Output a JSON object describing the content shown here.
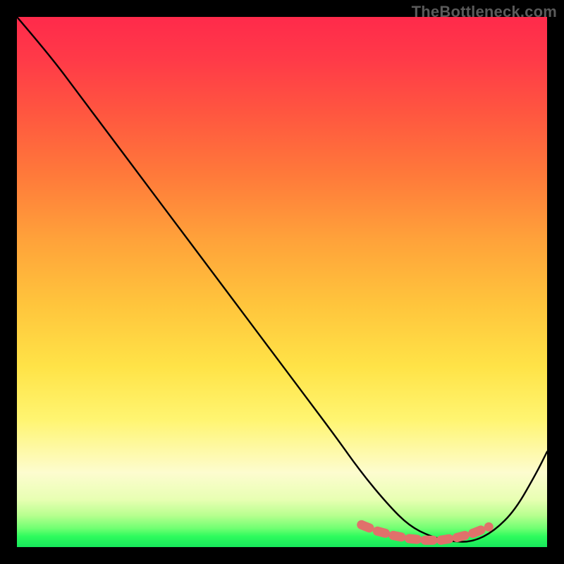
{
  "watermark": "TheBottleneck.com",
  "chart_data": {
    "type": "line",
    "title": "",
    "xlabel": "",
    "ylabel": "",
    "xlim": [
      0,
      100
    ],
    "ylim": [
      0,
      100
    ],
    "grid": false,
    "legend": false,
    "background_gradient": {
      "orientation": "vertical",
      "stops": [
        {
          "pos": 0.0,
          "color": "#ff2a4b"
        },
        {
          "pos": 0.3,
          "color": "#ff7a3a"
        },
        {
          "pos": 0.55,
          "color": "#ffc43c"
        },
        {
          "pos": 0.78,
          "color": "#fff571"
        },
        {
          "pos": 0.9,
          "color": "#e8ffb3"
        },
        {
          "pos": 1.0,
          "color": "#17e85b"
        }
      ]
    },
    "series": [
      {
        "name": "bottleneck-curve",
        "color": "#000000",
        "x": [
          0,
          6,
          12,
          18,
          24,
          30,
          36,
          42,
          48,
          54,
          60,
          65,
          70,
          74,
          78,
          82,
          86,
          90,
          94,
          98,
          100
        ],
        "y": [
          100,
          93,
          85,
          77,
          69,
          61,
          53,
          45,
          37,
          29,
          21,
          14,
          8,
          4,
          2,
          1,
          1,
          3,
          7,
          14,
          18
        ]
      }
    ],
    "highlight": {
      "name": "optimal-range-markers",
      "color": "#e0716b",
      "marker": "circle",
      "x": [
        65,
        68,
        71,
        74,
        77,
        80,
        83,
        86,
        89
      ],
      "y": [
        4.2,
        3.0,
        2.2,
        1.6,
        1.3,
        1.3,
        1.8,
        2.6,
        3.8
      ]
    }
  }
}
